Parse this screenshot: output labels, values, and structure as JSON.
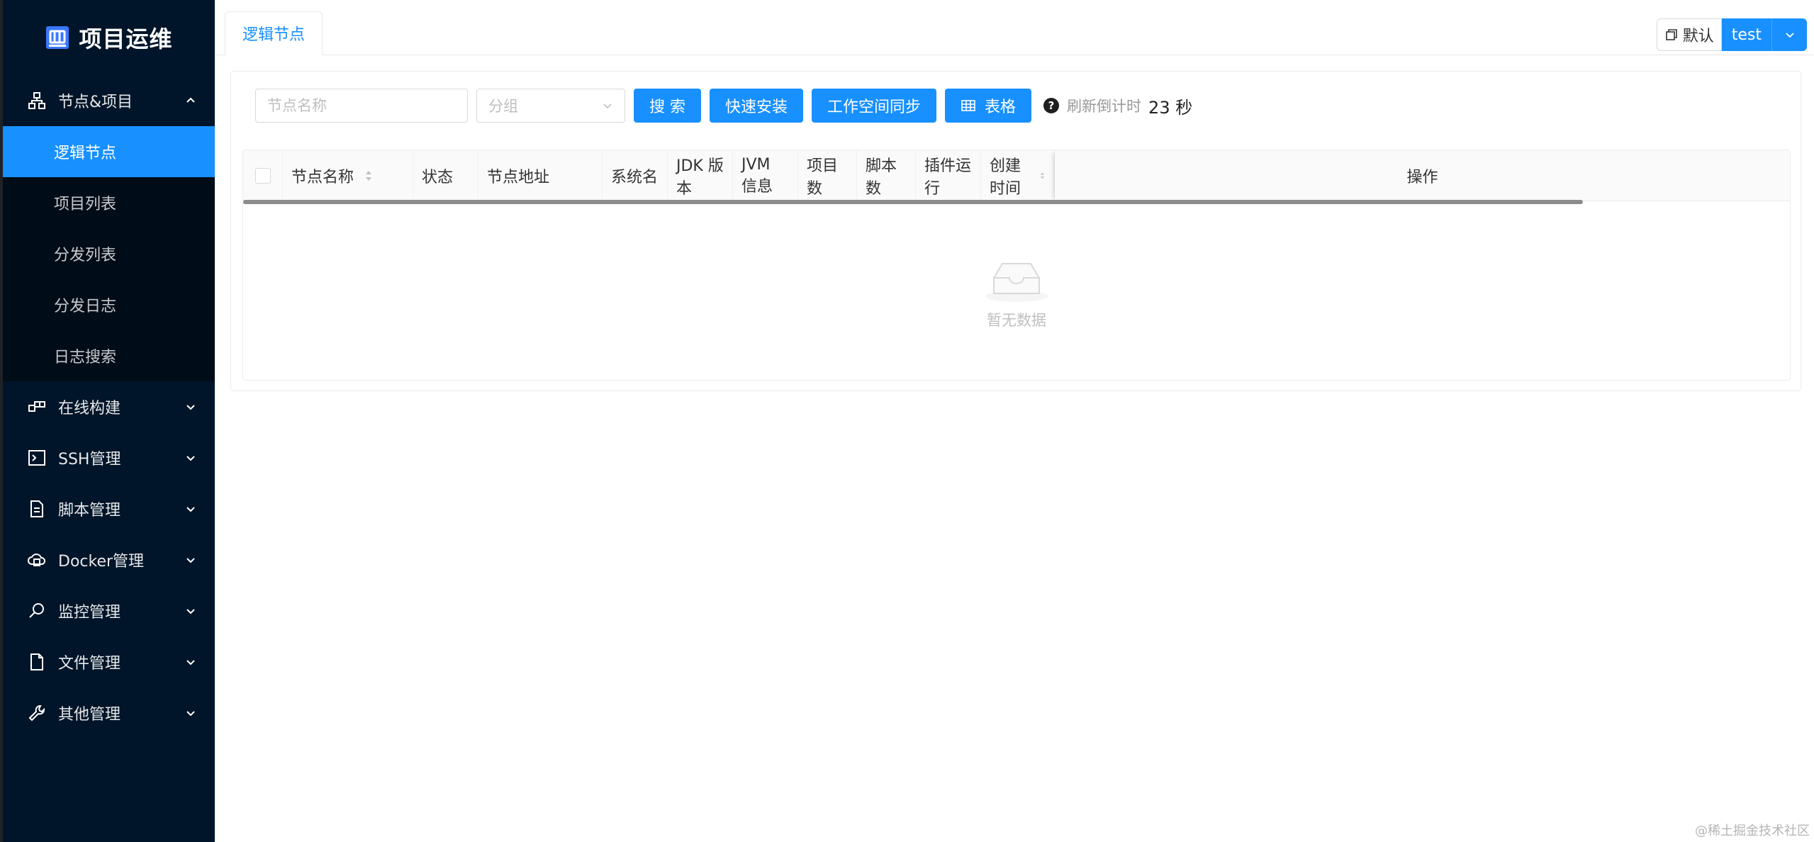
{
  "app": {
    "title": "项目运维"
  },
  "sidebar": {
    "groups": [
      {
        "label": "节点&项目",
        "icon": "cluster-icon",
        "expanded": true,
        "items": [
          {
            "label": "逻辑节点",
            "active": true
          },
          {
            "label": "项目列表"
          },
          {
            "label": "分发列表"
          },
          {
            "label": "分发日志"
          },
          {
            "label": "日志搜索"
          }
        ]
      },
      {
        "label": "在线构建",
        "icon": "build-icon"
      },
      {
        "label": "SSH管理",
        "icon": "terminal-icon"
      },
      {
        "label": "脚本管理",
        "icon": "script-file-icon"
      },
      {
        "label": "Docker管理",
        "icon": "cloud-server-icon"
      },
      {
        "label": "监控管理",
        "icon": "monitor-search-icon"
      },
      {
        "label": "文件管理",
        "icon": "file-icon"
      },
      {
        "label": "其他管理",
        "icon": "wrench-icon"
      }
    ]
  },
  "header": {
    "tab": "逻辑节点",
    "workspace": "默认",
    "user": "test"
  },
  "toolbar": {
    "name_placeholder": "节点名称",
    "group_placeholder": "分组",
    "search_label": "搜 索",
    "quick_install_label": "快速安装",
    "workspace_sync_label": "工作空间同步",
    "table_label": "表格",
    "refresh_text": "刷新倒计时",
    "refresh_seconds": "23",
    "refresh_unit": "秒"
  },
  "table": {
    "columns": [
      "节点名称",
      "状态",
      "节点地址",
      "系统名",
      "JDK 版本",
      "JVM 信息",
      "项目数",
      "脚本数",
      "插件运行",
      "创建时间",
      "操作"
    ],
    "sortable": [
      "节点名称",
      "创建时间"
    ],
    "rows": [],
    "empty_text": "暂无数据"
  },
  "watermark": "@稀土掘金技术社区",
  "colors": {
    "sidebar_bg": "#001529",
    "submenu_bg": "#000c17",
    "primary": "#1890ff"
  }
}
